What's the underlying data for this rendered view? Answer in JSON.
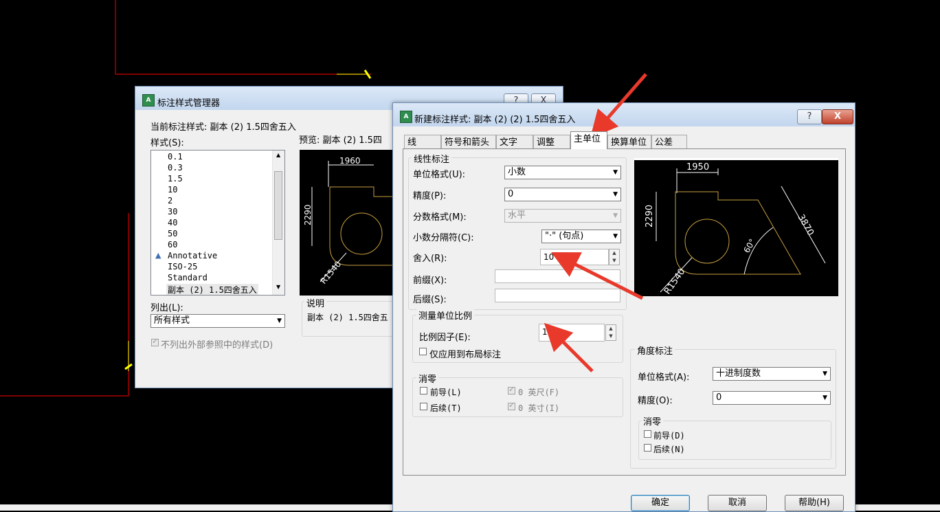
{
  "manager": {
    "title": "标注样式管理器",
    "current_label": "当前标注样式: 副本 (2) 1.5四舍五入",
    "styles_label": "样式(S):",
    "preview_label": "预览: 副本 (2) 1.5四",
    "styles": [
      "0.1",
      "0.3",
      "1.5",
      "10",
      "2",
      "30",
      "40",
      "50",
      "60",
      "Annotative",
      "ISO-25",
      "Standard",
      "副本 (2) 1.5四舍五入"
    ],
    "list_label": "列出(L):",
    "list_value": "所有样式",
    "no_xref_label": "不列出外部参照中的样式(D)",
    "desc_label": "说明",
    "desc_value": "副本 (2) 1.5四舍五",
    "preview_dims": {
      "width": "1960",
      "height": "2290",
      "radius": "R1540"
    },
    "help_btn": "?",
    "close_btn": "X"
  },
  "dialog": {
    "title": "新建标注样式: 副本 (2) (2) 1.5四舍五入",
    "help_btn": "?",
    "close_btn": "X",
    "tabs": [
      "线",
      "符号和箭头",
      "文字",
      "调整",
      "主单位",
      "换算单位",
      "公差"
    ],
    "active_tab": 4,
    "linear": {
      "group_title": "线性标注",
      "unit_format_label": "单位格式(U):",
      "unit_format_value": "小数",
      "precision_label": "精度(P):",
      "precision_value": "0",
      "fraction_label": "分数格式(M):",
      "fraction_value": "水平",
      "decimal_sep_label": "小数分隔符(C):",
      "decimal_sep_value": "\"·\" (句点)",
      "round_label": "舍入(R):",
      "round_value": "10",
      "prefix_label": "前缀(X):",
      "prefix_value": "",
      "suffix_label": "后缀(S):",
      "suffix_value": ""
    },
    "scale": {
      "group_title": "测量单位比例",
      "factor_label": "比例因子(E):",
      "factor_value": "1",
      "layout_only_label": "仅应用到布局标注"
    },
    "zero": {
      "group_title": "消零",
      "leading_label": "前导(L)",
      "trailing_label": "后续(T)",
      "feet_label": "0 英尺(F)",
      "inches_label": "0 英寸(I)"
    },
    "preview_dims": {
      "width": "1950",
      "height": "2290",
      "radius": "R1540",
      "angle": "60°",
      "slant": "3870"
    },
    "angular": {
      "group_title": "角度标注",
      "unit_format_label": "单位格式(A):",
      "unit_format_value": "十进制度数",
      "precision_label": "精度(O):",
      "precision_value": "0",
      "zero_title": "消零",
      "leading_label": "前导(D)",
      "trailing_label": "后续(N)"
    },
    "buttons": {
      "ok": "确定",
      "cancel": "取消",
      "help": "帮助(H)"
    }
  },
  "colors": {
    "cad_background": "#000000",
    "cad_red": "#cc0000",
    "cad_yellow": "#ffff00",
    "annotation_arrow": "#e8392b",
    "preview_line": "#c8a040"
  }
}
